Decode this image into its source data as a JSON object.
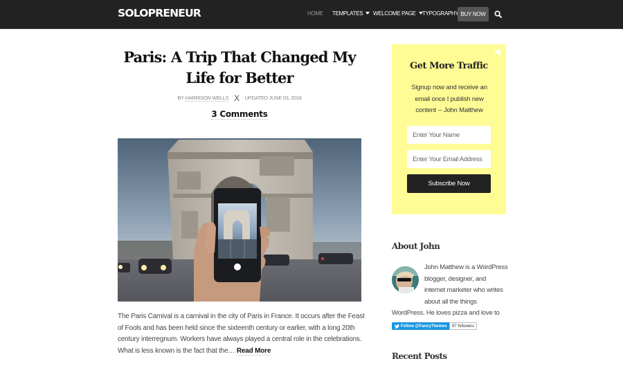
{
  "header": {
    "logo": "SOLOPRENEUR",
    "nav": [
      {
        "label": "HOME",
        "active": true,
        "has_dropdown": false
      },
      {
        "label": "TEMPLATES",
        "active": false,
        "has_dropdown": true
      },
      {
        "label": "WELCOME PAGE",
        "active": false,
        "has_dropdown": true
      },
      {
        "label": "TYPOGRAPHY",
        "active": false,
        "has_dropdown": false
      }
    ],
    "cta": "BUY NOW",
    "search_icon": "search-icon"
  },
  "post": {
    "title": "Paris: A Trip That Changed My Life for Better",
    "author_prefix": "BY",
    "author": "HARRISON WELLS",
    "separator": "X",
    "updated": "UPDATED JUNE 03, 2016",
    "comments": "3 Comments",
    "image_alt": "Hand holding a phone photographing the Arc de Triomphe",
    "excerpt": "The Paris Carnival is a carnival in the city of Paris in France. It occurs after the Feast of Fools and has been held since the sixteenth century or earlier, with a long 20th century interregnum. Workers have always played a central role in the celebrations. What is less known is the fact that the…",
    "read_more": "Read More"
  },
  "sidebar": {
    "optin": {
      "title": "Get More Traffic",
      "text": "Signup now and receive an email once I publish new content -- John Matthew",
      "name_placeholder": "Enter Your Name",
      "email_placeholder": "Enter Your Email Address",
      "button": "Subscribe Now",
      "bg_color": "#fffc95"
    },
    "about": {
      "title": "About John",
      "text": "John Matthew is a WordPress blogger, designer, and internet marketer who writes about all the things WordPress. He loves pizza and love to write code.",
      "twitter_button": "Follow @FancyThemes",
      "followers": "97 followers"
    },
    "recent_posts_title": "Recent Posts"
  },
  "colors": {
    "header_bg": "#222222",
    "buy_now_bg": "#555555",
    "twitter_blue": "#1b95e0"
  }
}
